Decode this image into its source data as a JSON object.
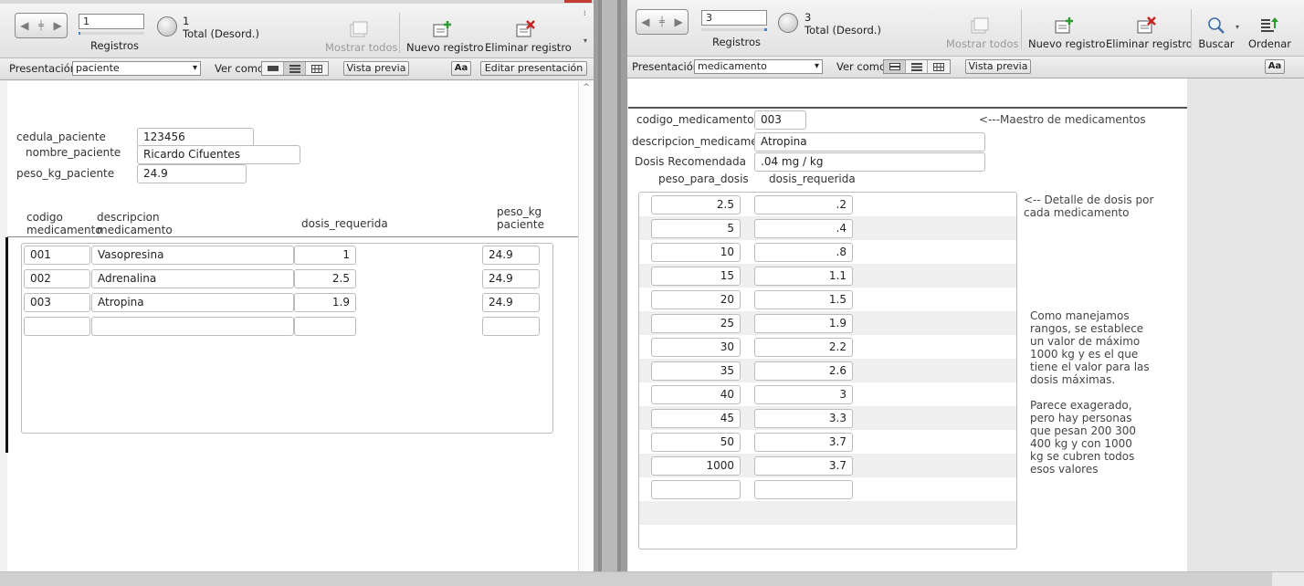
{
  "left": {
    "toolbar": {
      "record_number": "1",
      "records_label": "Registros",
      "total_count": "1",
      "total_label": "Total (Desord.)",
      "show_all": "Mostrar todos",
      "new_record": "Nuevo registro",
      "delete_record": "Eliminar registro"
    },
    "layoutbar": {
      "layout_label": "Presentación:",
      "layout_value": "paciente",
      "view_as": "Ver como:",
      "preview": "Vista previa",
      "font_btn": "Aa",
      "edit_layout": "Editar presentación"
    },
    "form": {
      "cedula_label": "cedula_paciente",
      "cedula_value": "123456",
      "nombre_label": "nombre_paciente",
      "nombre_value": "Ricardo Cifuentes",
      "peso_label": "peso_kg_paciente",
      "peso_value": "24.9",
      "hdr_codigo_1": "codigo",
      "hdr_codigo_2": "medicamento",
      "hdr_desc_1": "descripcion",
      "hdr_desc_2": "medicamento",
      "hdr_dosis": "dosis_requerida",
      "hdr_peso_1": "peso_kg",
      "hdr_peso_2": "paciente"
    },
    "rows": [
      {
        "codigo": "001",
        "desc": "Vasopresina",
        "dosis": "1",
        "peso": "24.9"
      },
      {
        "codigo": "002",
        "desc": "Adrenalina",
        "dosis": "2.5",
        "peso": "24.9"
      },
      {
        "codigo": "003",
        "desc": "Atropina",
        "dosis": "1.9",
        "peso": "24.9"
      },
      {
        "codigo": "",
        "desc": "",
        "dosis": "",
        "peso": ""
      }
    ]
  },
  "right": {
    "toolbar": {
      "record_number": "3",
      "records_label": "Registros",
      "total_count": "3",
      "total_label": "Total (Desord.)",
      "show_all": "Mostrar todos",
      "new_record": "Nuevo registro",
      "delete_record": "Eliminar registro",
      "search": "Buscar",
      "sort": "Ordenar"
    },
    "layoutbar": {
      "layout_label": "Presentación:",
      "layout_value": "medicamento",
      "view_as": "Ver como:",
      "preview": "Vista previa",
      "font_btn": "Aa"
    },
    "form": {
      "codigo_label": "codigo_medicamento",
      "codigo_value": "003",
      "master_note": "<---Maestro de medicamentos",
      "desc_label": "descripcion_medicament",
      "desc_value": "Atropina",
      "dosis_rec_label": "Dosis Recomendada",
      "dosis_rec_value": ".04 mg / kg",
      "hdr_peso": "peso_para_dosis",
      "hdr_dosis": "dosis_requerida",
      "detail_note_1": "<-- Detalle de dosis por",
      "detail_note_2": "cada medicamento",
      "range_note": [
        "Como manejamos",
        "rangos, se establece",
        "un valor de máximo",
        "1000 kg y es el que",
        "tiene el valor para las",
        "dosis máximas."
      ],
      "exag_note": [
        "Parece exagerado,",
        "pero hay personas",
        "que pesan 200 300",
        "400 kg y con 1000",
        "kg se cubren todos",
        "esos valores"
      ]
    },
    "rows": [
      {
        "peso": "2.5",
        "dosis": ".2"
      },
      {
        "peso": "5",
        "dosis": ".4"
      },
      {
        "peso": "10",
        "dosis": ".8"
      },
      {
        "peso": "15",
        "dosis": "1.1"
      },
      {
        "peso": "20",
        "dosis": "1.5"
      },
      {
        "peso": "25",
        "dosis": "1.9"
      },
      {
        "peso": "30",
        "dosis": "2.2"
      },
      {
        "peso": "35",
        "dosis": "2.6"
      },
      {
        "peso": "40",
        "dosis": "3"
      },
      {
        "peso": "45",
        "dosis": "3.3"
      },
      {
        "peso": "50",
        "dosis": "3.7"
      },
      {
        "peso": "1000",
        "dosis": "3.7"
      },
      {
        "peso": "",
        "dosis": ""
      }
    ]
  }
}
